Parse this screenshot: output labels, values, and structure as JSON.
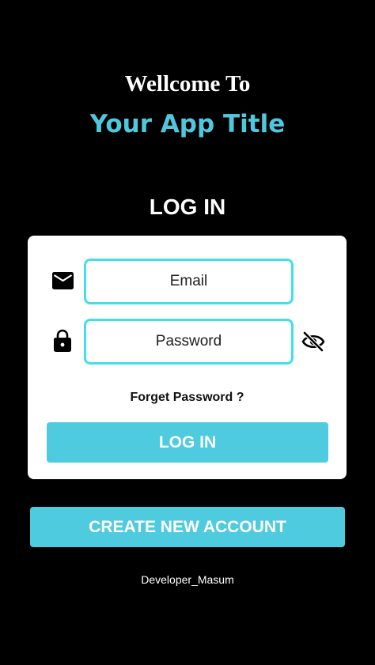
{
  "header": {
    "welcome": "Wellcome To",
    "app_title": "Your App Title",
    "login_heading": "LOG IN"
  },
  "form": {
    "email_placeholder": "Email",
    "email_value": "",
    "password_placeholder": "Password",
    "password_value": "",
    "forget_password": "Forget Password ?",
    "login_button": "LOG IN"
  },
  "create_account_button": "CREATE NEW ACCOUNT",
  "footer": {
    "developer": "Developer_Masum"
  },
  "icons": {
    "email": "mail-icon",
    "password": "lock-icon",
    "toggle_visibility": "eye-off-icon"
  },
  "colors": {
    "background": "#000000",
    "accent": "#4fcbe0",
    "field_border": "#41dfe8",
    "title": "#4fc8de"
  }
}
